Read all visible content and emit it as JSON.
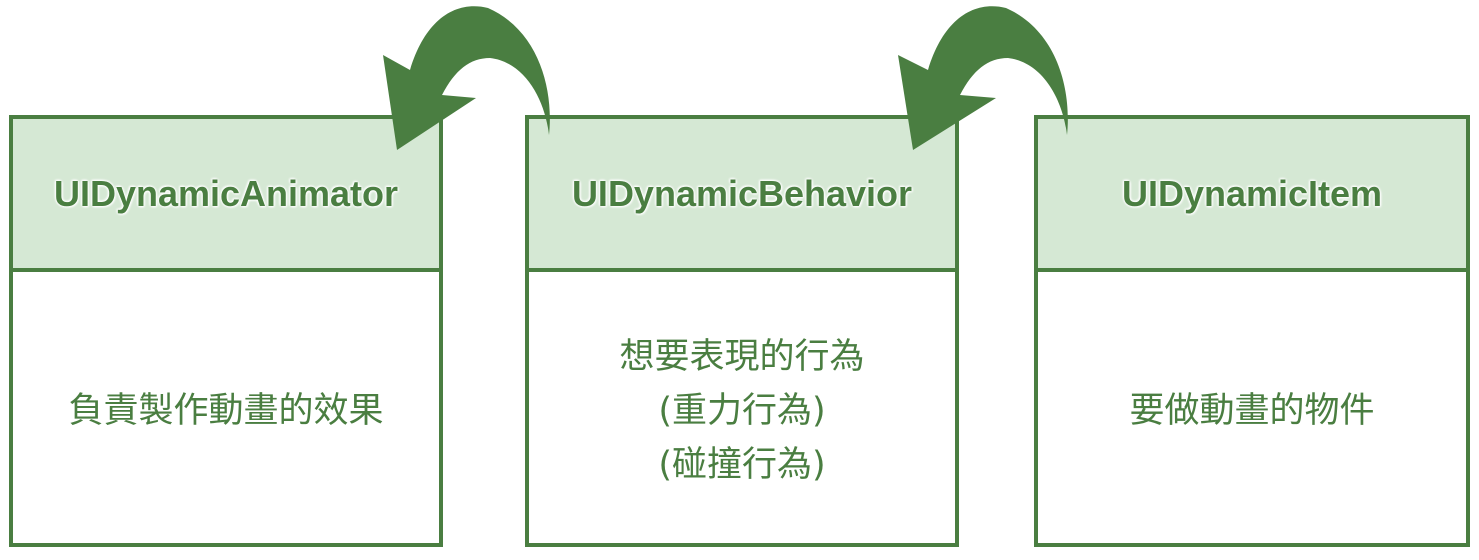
{
  "colors": {
    "stroke": "#4a7e41",
    "header_fill": "#d5e8d4",
    "body_fill": "#ffffff",
    "text": "#4a7e41"
  },
  "boxes": [
    {
      "title": "UIDynamicAnimator",
      "lines": [
        "負責製作動畫的效果"
      ]
    },
    {
      "title": "UIDynamicBehavior",
      "lines": [
        "想要表現的行為",
        "(重力行為)",
        "(碰撞行為)"
      ]
    },
    {
      "title": "UIDynamicItem",
      "lines": [
        "要做動畫的物件"
      ]
    }
  ],
  "arrows": [
    {
      "from": "UIDynamicBehavior",
      "to": "UIDynamicAnimator",
      "icon": "curved-arrow-icon"
    },
    {
      "from": "UIDynamicItem",
      "to": "UIDynamicBehavior",
      "icon": "curved-arrow-icon"
    }
  ]
}
